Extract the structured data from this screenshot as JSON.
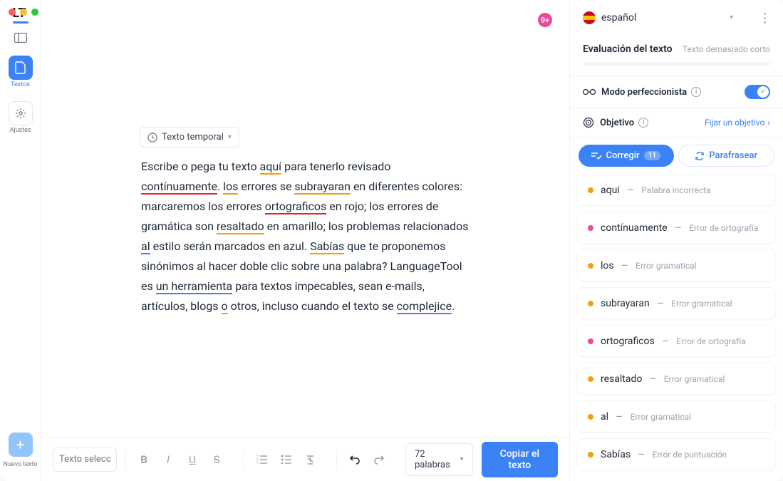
{
  "leftbar": {
    "logo": "LT",
    "textos": "Textos",
    "ajustes": "Ajustes",
    "nuevo": "Nuevo texto"
  },
  "header": {
    "badge": "9+",
    "temp_button": "Texto temporal"
  },
  "editor": {
    "t1": "Escribe o pega tu texto ",
    "w_aqui": "aquí",
    "t2": " para tenerlo revisado ",
    "w_continuamente": "contínuamente",
    "t3": ". ",
    "w_los": "los",
    "t4": " errores se ",
    "w_subrayaran": "subrayaran",
    "t5": " en diferentes colores: marcaremos los errores ",
    "w_ortograficos": "ortograficos",
    "t6": " en rojo; los errores de gramática son ",
    "w_resaltado": "resaltado",
    "t7": " en amarillo; los problemas relacionados ",
    "w_al": "al",
    "t8": " estilo serán marcados en azul. ",
    "w_sabias": "Sabías",
    "t9": " que te proponemos sinónimos al hacer doble clic sobre una palabra? LanguageTool es ",
    "w_herramienta": "un herramienta",
    "t10": " para textos impecables, sean e-mails, artículos, blogs ",
    "w_o": "o",
    "t11": " otros, incluso cuando el texto se ",
    "w_complejice": "complejice",
    "t12": "."
  },
  "bottombar": {
    "font_placeholder": "Texto seleccionado",
    "wordcount": "72 palabras",
    "copy": "Copiar el texto"
  },
  "rightpanel": {
    "language": "español",
    "eval_title": "Evaluación del texto",
    "eval_note": "Texto demasiado corto",
    "perfeccionista": "Modo perfeccionista",
    "objetivo": "Objetivo",
    "fijar": "Fijar un objetivo",
    "tab_corregir": "Corregir",
    "tab_count": "11",
    "tab_parafrasear": "Parafrasear"
  },
  "issues": [
    {
      "color": "yellow",
      "word": "aqui",
      "type": "Palabra incorrecta"
    },
    {
      "color": "red",
      "word": "contínuamente",
      "type": "Error de ortografía"
    },
    {
      "color": "yellow",
      "word": "los",
      "type": "Error gramatical"
    },
    {
      "color": "yellow",
      "word": "subrayaran",
      "type": "Error gramatical"
    },
    {
      "color": "red",
      "word": "ortograficos",
      "type": "Error de ortografía"
    },
    {
      "color": "yellow",
      "word": "resaltado",
      "type": "Error gramatical"
    },
    {
      "color": "yellow",
      "word": "al",
      "type": "Error gramatical"
    },
    {
      "color": "yellow",
      "word": "Sabías",
      "type": "Error de puntuación"
    }
  ]
}
